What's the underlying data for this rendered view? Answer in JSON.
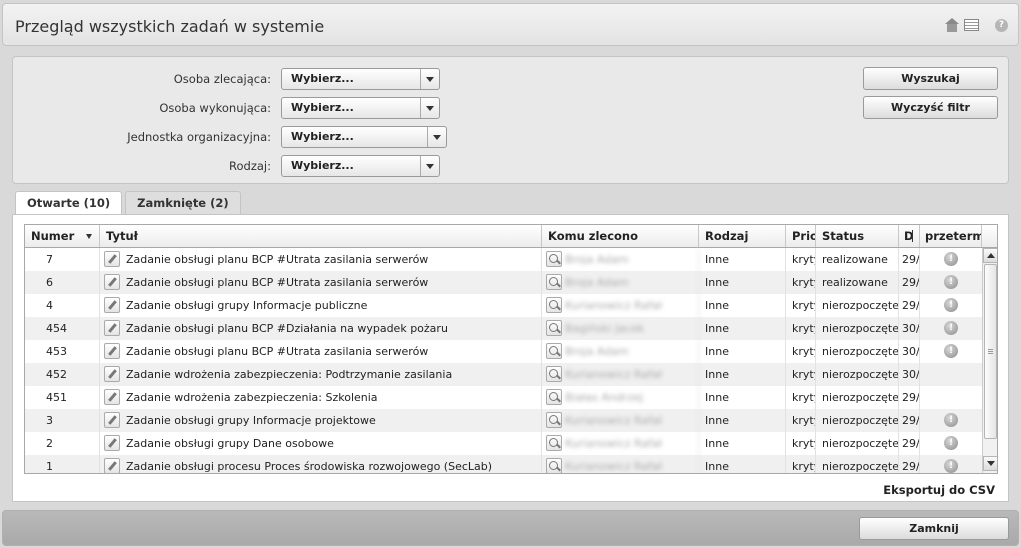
{
  "header": {
    "title": "Przegląd wszystkich zadań w systemie",
    "help_label": "?"
  },
  "filters": [
    {
      "label": "Osoba zlecająca:",
      "value": "Wybierz..."
    },
    {
      "label": "Osoba wykonująca:",
      "value": "Wybierz..."
    },
    {
      "label": "Jednostka organizacyjna:",
      "value": "Wybierz..."
    },
    {
      "label": "Rodzaj:",
      "value": "Wybierz..."
    }
  ],
  "buttons": {
    "search": "Wyszukaj",
    "clear": "Wyczyść filtr",
    "close": "Zamknij"
  },
  "tabs": [
    {
      "label": "Otwarte (10)"
    },
    {
      "label": "Zamknięte (2)"
    }
  ],
  "table": {
    "columns": [
      "Numer",
      "Tytuł",
      "Komu zlecono",
      "Rodzaj",
      "Prio",
      "Status",
      "D",
      "przeterm"
    ],
    "rows": [
      {
        "number": "7",
        "title": "Zadanie obsługi planu BCP #Utrata zasilania serwerów",
        "assignee": "Broja Adam",
        "type": "Inne",
        "priority": "krytyczny",
        "status": "realizowane",
        "date": "29/",
        "alert": "!"
      },
      {
        "number": "6",
        "title": "Zadanie obsługi planu BCP #Utrata zasilania serwerów",
        "assignee": "Broja Adam",
        "type": "Inne",
        "priority": "krytyczny",
        "status": "realizowane",
        "date": "29/",
        "alert": "!"
      },
      {
        "number": "4",
        "title": "Zadanie obsługi grupy Informacje publiczne",
        "assignee": "Kurianowicz Rafał",
        "type": "Inne",
        "priority": "krytyczny",
        "status": "nierozpoczęte",
        "date": "29/",
        "alert": "!"
      },
      {
        "number": "454",
        "title": "Zadanie obsługi planu BCP #Działania na wypadek pożaru",
        "assignee": "Bagiński Jacek",
        "type": "Inne",
        "priority": "krytyczny",
        "status": "nierozpoczęte",
        "date": "30/",
        "alert": "!"
      },
      {
        "number": "453",
        "title": "Zadanie obsługi planu BCP #Utrata zasilania serwerów",
        "assignee": "Broja Adam",
        "type": "Inne",
        "priority": "krytyczny",
        "status": "nierozpoczęte",
        "date": "30/",
        "alert": "!"
      },
      {
        "number": "452",
        "title": "Zadanie wdrożenia zabezpieczenia: Podtrzymanie zasilania",
        "assignee": "Kurianowicz Rafał",
        "type": "Inne",
        "priority": "krytyczny",
        "status": "nierozpoczęte",
        "date": "30/",
        "alert": ""
      },
      {
        "number": "451",
        "title": "Zadanie wdrożenia zabezpieczenia: Szkolenia",
        "assignee": "Białas Andrzej",
        "type": "Inne",
        "priority": "krytyczny",
        "status": "nierozpoczęte",
        "date": "29/",
        "alert": ""
      },
      {
        "number": "3",
        "title": "Zadanie obsługi grupy Informacje projektowe",
        "assignee": "Kurianowicz Rafał",
        "type": "Inne",
        "priority": "krytyczny",
        "status": "nierozpoczęte",
        "date": "29/",
        "alert": "!"
      },
      {
        "number": "2",
        "title": "Zadanie obsługi grupy Dane osobowe",
        "assignee": "Kurianowicz Rafał",
        "type": "Inne",
        "priority": "krytyczny",
        "status": "nierozpoczęte",
        "date": "29/",
        "alert": "!"
      },
      {
        "number": "1",
        "title": "Zadanie obsługi procesu Proces środowiska rozwojowego (SecLab)",
        "assignee": "Kurianowicz Rafał",
        "type": "Inne",
        "priority": "krytyczny",
        "status": "nierozpoczęte",
        "date": "29/",
        "alert": "!"
      }
    ]
  },
  "export_label": "Eksportuj do CSV"
}
